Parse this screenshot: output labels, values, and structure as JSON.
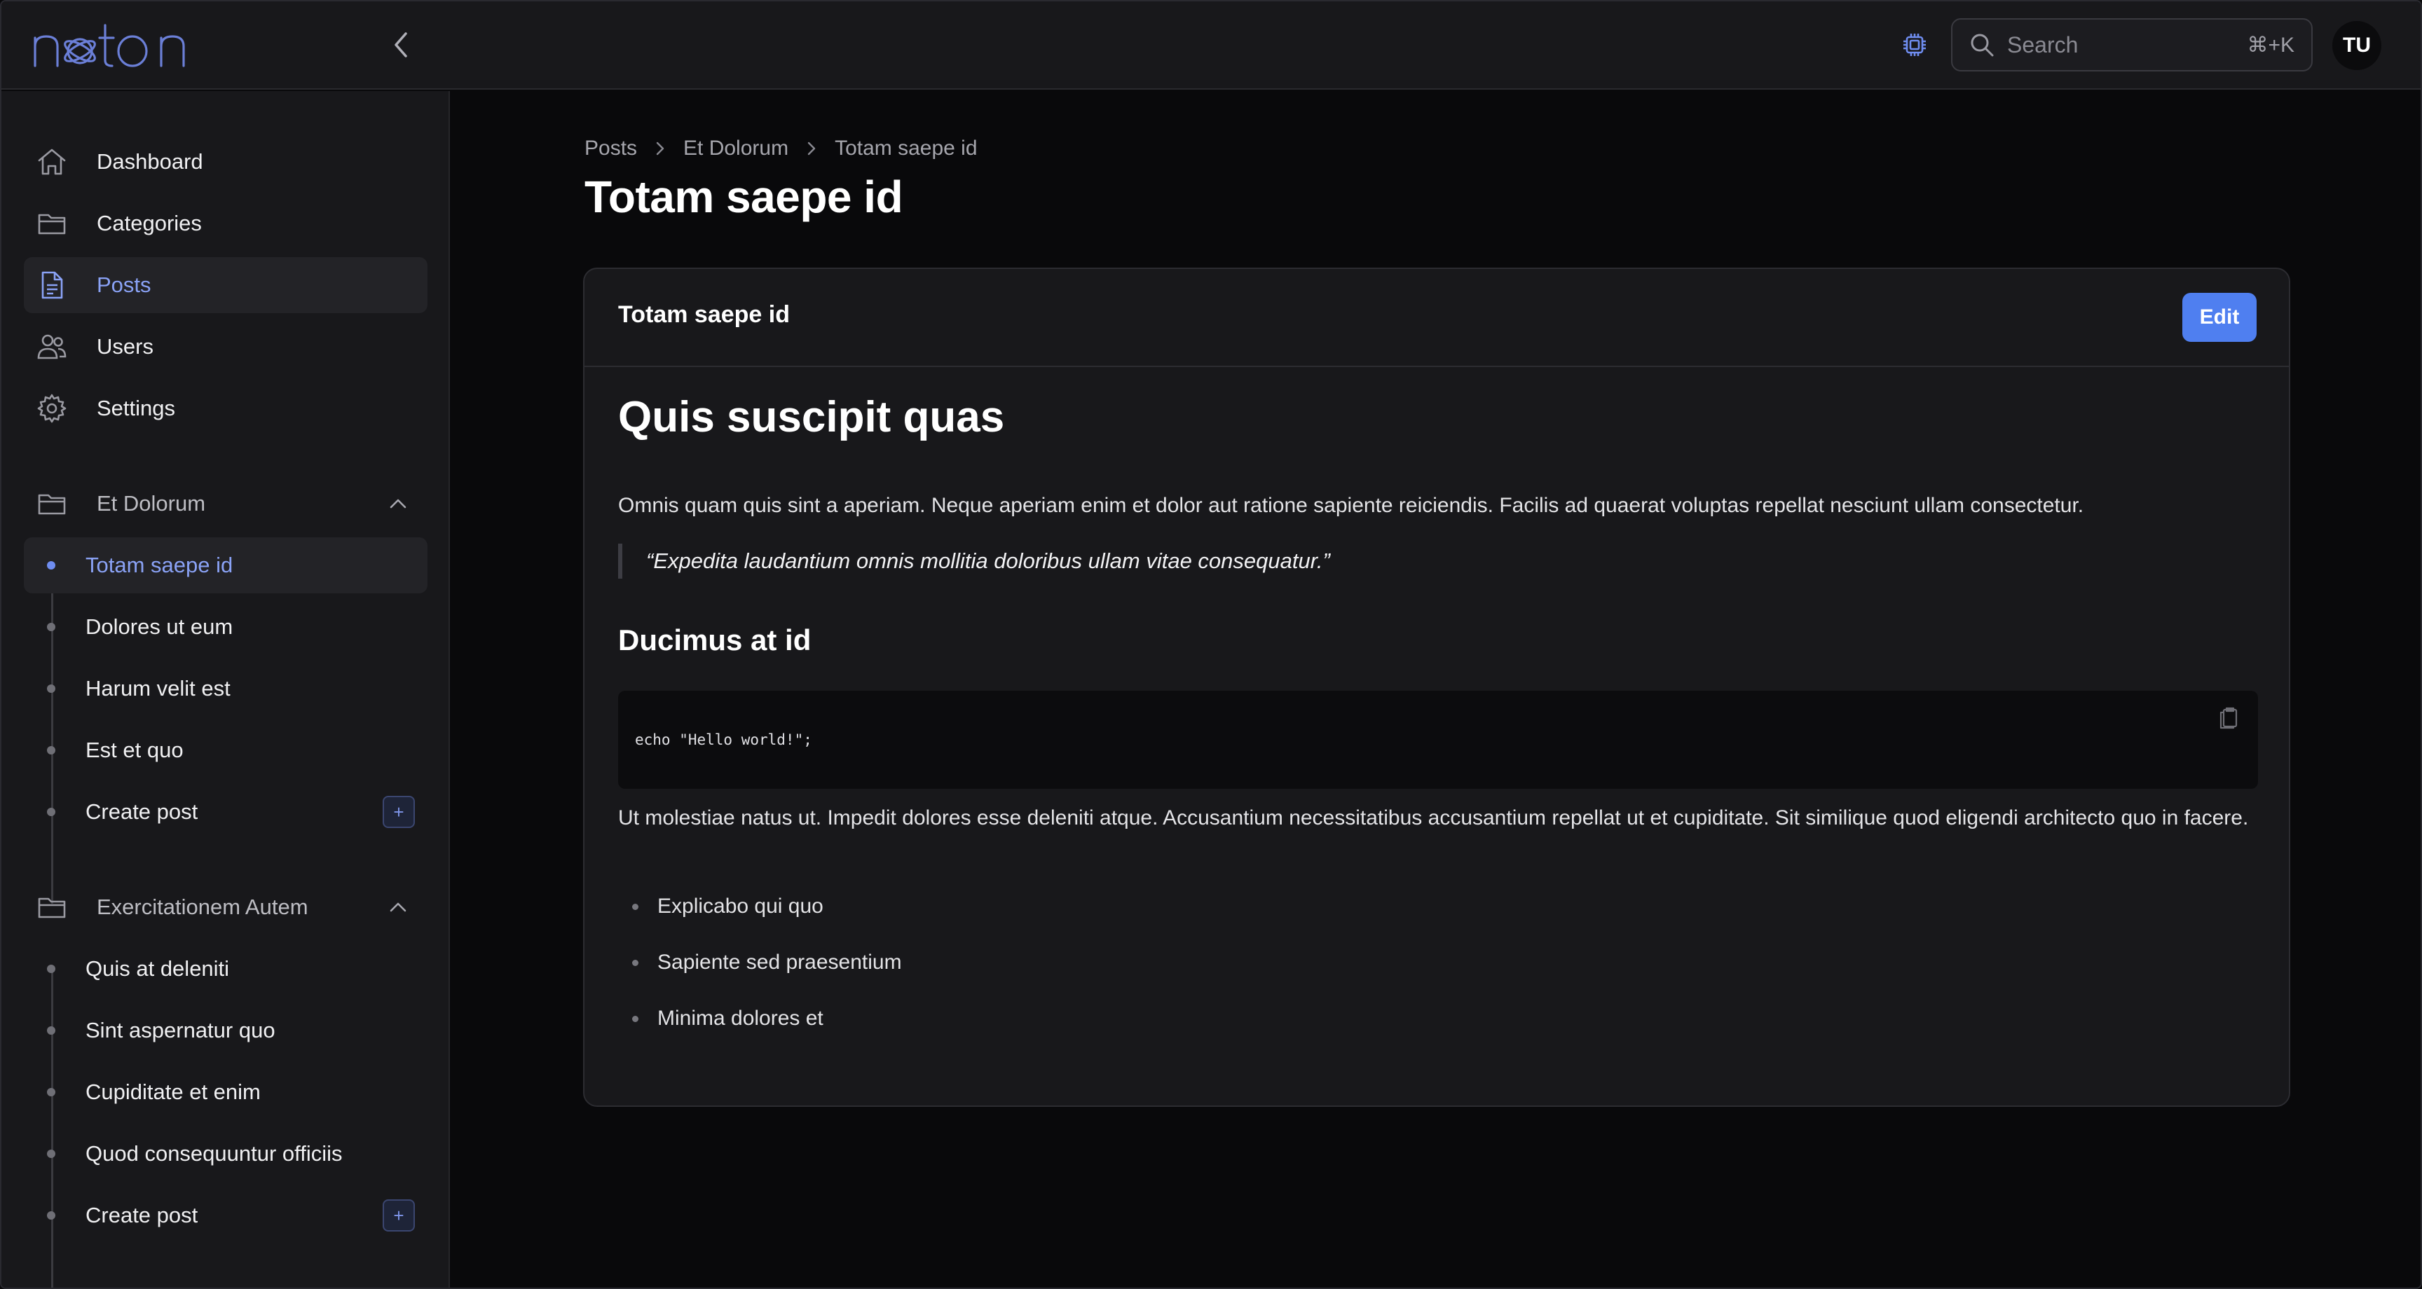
{
  "app": {
    "logo_text": "neton",
    "accent_color": "#4f7ff0",
    "link_color": "#8aa2f5"
  },
  "header": {
    "search_placeholder": "Search",
    "search_shortcut": "⌘+K",
    "avatar_initials": "TU",
    "icons": [
      "chevron-left-icon",
      "cpu-chip-icon",
      "search-icon"
    ]
  },
  "sidebar": {
    "nav": [
      {
        "label": "Dashboard",
        "icon": "home-icon"
      },
      {
        "label": "Categories",
        "icon": "folder-icon"
      },
      {
        "label": "Posts",
        "icon": "document-icon",
        "active": true
      },
      {
        "label": "Users",
        "icon": "users-icon"
      },
      {
        "label": "Settings",
        "icon": "gear-icon"
      }
    ],
    "groups": [
      {
        "label": "Et Dolorum",
        "expanded": true,
        "items": [
          "Totam saepe id",
          "Dolores ut eum",
          "Harum velit est",
          "Est et quo",
          "Create post"
        ],
        "active_item": "Totam saepe id"
      },
      {
        "label": "Exercitationem Autem",
        "expanded": true,
        "items": [
          "Quis at deleniti",
          "Sint aspernatur quo",
          "Cupiditate et enim",
          "Quod consequuntur officiis",
          "Create post"
        ]
      }
    ],
    "create_button_label": "+"
  },
  "main": {
    "breadcrumb": [
      "Posts",
      "Et Dolorum",
      "Totam saepe id"
    ],
    "page_title": "Totam saepe id",
    "card": {
      "title": "Totam saepe id",
      "edit_label": "Edit",
      "heading": "Quis suscipit quas",
      "paragraph1": "Omnis quam quis sint a aperiam. Neque aperiam enim et dolor aut ratione sapiente reiciendis. Facilis ad quaerat voluptas repellat nesciunt ullam consectetur.",
      "quote": "“Expedita laudantium omnis mollitia doloribus ullam vitae consequatur.”",
      "subheading": "Ducimus at id",
      "code": "echo \"Hello world!\";",
      "paragraph2": "Ut molestiae natus ut. Impedit dolores esse deleniti atque. Accusantium necessitatibus accusantium repellat ut et cupiditate. Sit similique quod eligendi architecto quo in facere.",
      "list": [
        "Explicabo qui quo",
        "Sapiente sed praesentium",
        "Minima dolores et"
      ]
    }
  }
}
